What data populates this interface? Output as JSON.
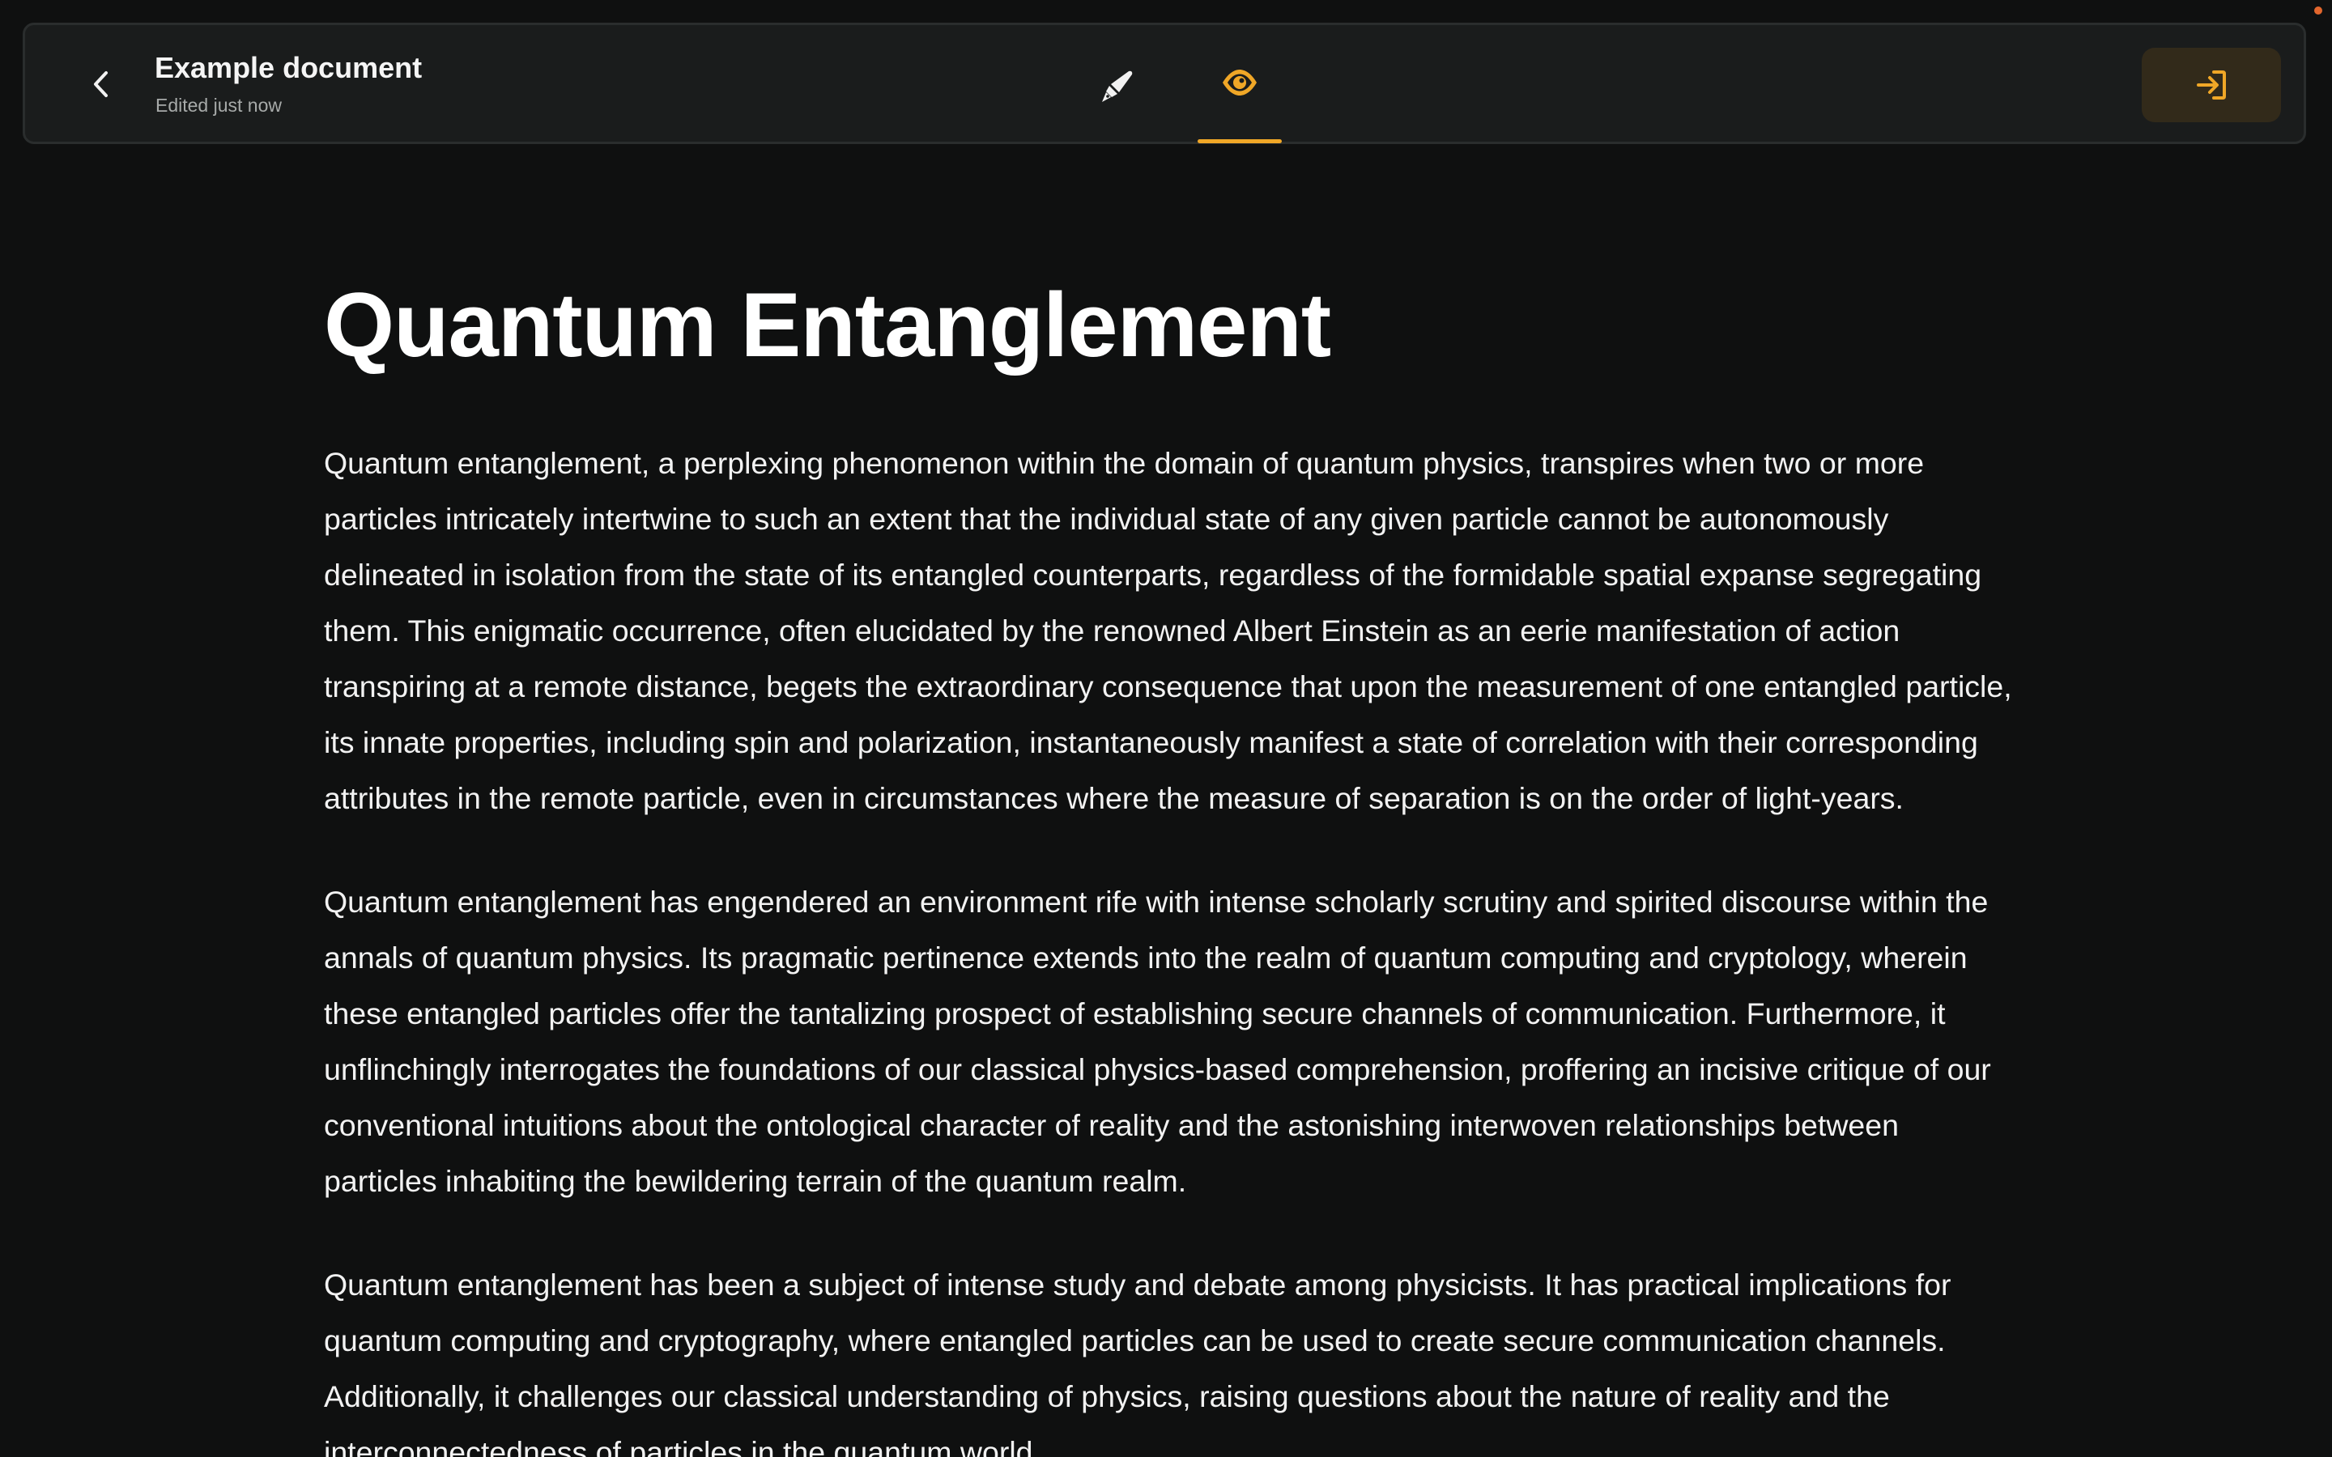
{
  "header": {
    "back_icon": "chevron-left-icon",
    "title": "Example document",
    "subtitle": "Edited just now",
    "tabs": [
      {
        "id": "edit",
        "icon": "pen-icon",
        "active": false
      },
      {
        "id": "preview",
        "icon": "eye-icon",
        "active": true
      }
    ],
    "signin_icon": "sign-in-icon"
  },
  "colors": {
    "background": "#0f1010",
    "header_bg": "#1a1c1c",
    "accent": "#f0a727",
    "signin_bg": "#322a1a",
    "notification_dot": "#e2662d"
  },
  "document": {
    "title": "Quantum Entanglement",
    "paragraphs": [
      "Quantum entanglement, a perplexing phenomenon within the domain of quantum physics, transpires when two or more particles intricately intertwine to such an extent that the individual state of any given particle cannot be autonomously delineated in isolation from the state of its entangled counterparts, regardless of the formidable spatial expanse segregating them. This enigmatic occurrence, often elucidated by the renowned Albert Einstein as an eerie manifestation of action transpiring at a remote distance, begets the extraordinary consequence that upon the measurement of one entangled particle, its innate properties, including spin and polarization, instantaneously manifest a state of correlation with their corresponding attributes in the remote particle, even in circumstances where the measure of separation is on the order of light-years.",
      "Quantum entanglement has engendered an environment rife with intense scholarly scrutiny and spirited discourse within the annals of quantum physics. Its pragmatic pertinence extends into the realm of quantum computing and cryptology, wherein these entangled particles offer the tantalizing prospect of establishing secure channels of communication. Furthermore, it unflinchingly interrogates the foundations of our classical physics-based comprehension, proffering an incisive critique of our conventional intuitions about the ontological character of reality and the astonishing interwoven relationships between particles inhabiting the bewildering terrain of the quantum realm.",
      "Quantum entanglement has been a subject of intense study and debate among physicists. It has practical implications for quantum computing and cryptography, where entangled particles can be used to create secure communication channels. Additionally, it challenges our classical understanding of physics, raising questions about the nature of reality and the interconnectedness of particles in the quantum world."
    ]
  }
}
